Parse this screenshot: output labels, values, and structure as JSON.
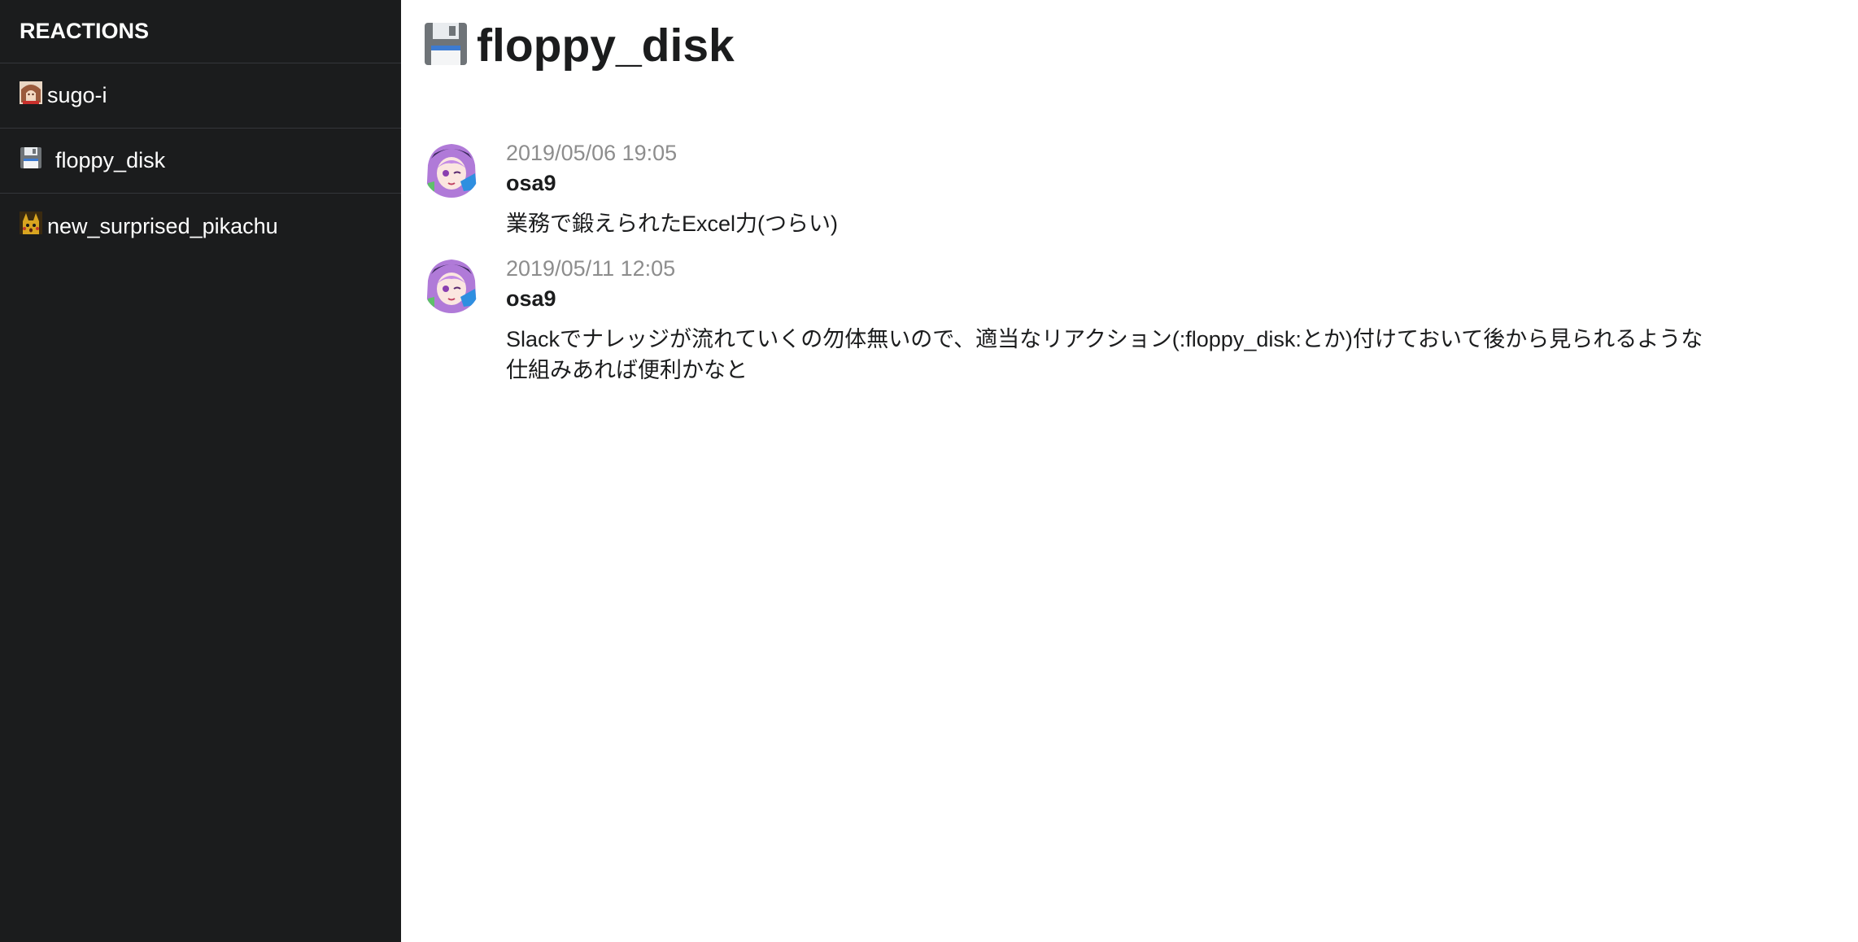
{
  "sidebar": {
    "header": "REACTIONS",
    "items": [
      {
        "label": "sugo-i",
        "icon": "sugo-i-emoji-icon"
      },
      {
        "label": "floppy_disk",
        "icon": "floppy-disk-icon"
      },
      {
        "label": "new_surprised_pikachu",
        "icon": "pikachu-emoji-icon"
      }
    ]
  },
  "main": {
    "title": "floppy_disk",
    "title_icon": "floppy-disk-icon",
    "messages": [
      {
        "timestamp": "2019/05/06 19:05",
        "user": "osa9",
        "text": "業務で鍛えられたExcel力(つらい)"
      },
      {
        "timestamp": "2019/05/11 12:05",
        "user": "osa9",
        "text": "Slackでナレッジが流れていくの勿体無いので、適当なリアクション(:floppy_disk:とか)付けておいて後から見られるような仕組みあれば便利かなと"
      }
    ]
  },
  "colors": {
    "sidebar_bg": "#1b1c1d",
    "divider": "#34363a",
    "timestamp": "#8d8d8d",
    "text": "#1b1c1d"
  }
}
